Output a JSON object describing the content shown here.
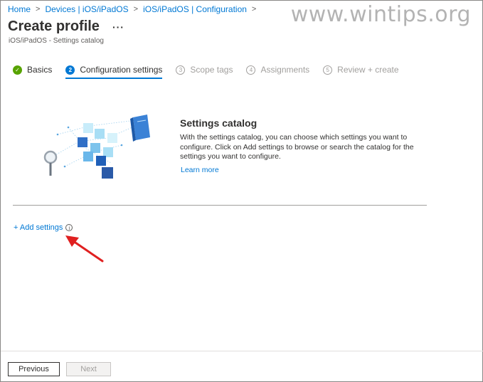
{
  "breadcrumb": [
    "Home",
    "Devices | iOS/iPadOS",
    "iOS/iPadOS | Configuration"
  ],
  "watermark": "www.wintips.org",
  "page": {
    "title": "Create profile",
    "more_label": "···",
    "subtitle": "iOS/iPadOS - Settings catalog"
  },
  "steps": [
    {
      "badge": "✓",
      "label": "Basics",
      "state": "done"
    },
    {
      "badge": "2",
      "label": "Configuration settings",
      "state": "active"
    },
    {
      "badge": "3",
      "label": "Scope tags",
      "state": "idle"
    },
    {
      "badge": "4",
      "label": "Assignments",
      "state": "idle"
    },
    {
      "badge": "5",
      "label": "Review + create",
      "state": "idle"
    }
  ],
  "catalog": {
    "title": "Settings catalog",
    "description": "With the settings catalog, you can choose which settings you want to configure. Click on Add settings to browse or search the catalog for the settings you want to configure.",
    "learn_more": "Learn more"
  },
  "add_settings": {
    "label": "+ Add settings",
    "info": "i"
  },
  "footer": {
    "previous": "Previous",
    "next": "Next"
  },
  "colors": {
    "link": "#0078d4",
    "done": "#57a300",
    "arrow": "#e02020"
  }
}
